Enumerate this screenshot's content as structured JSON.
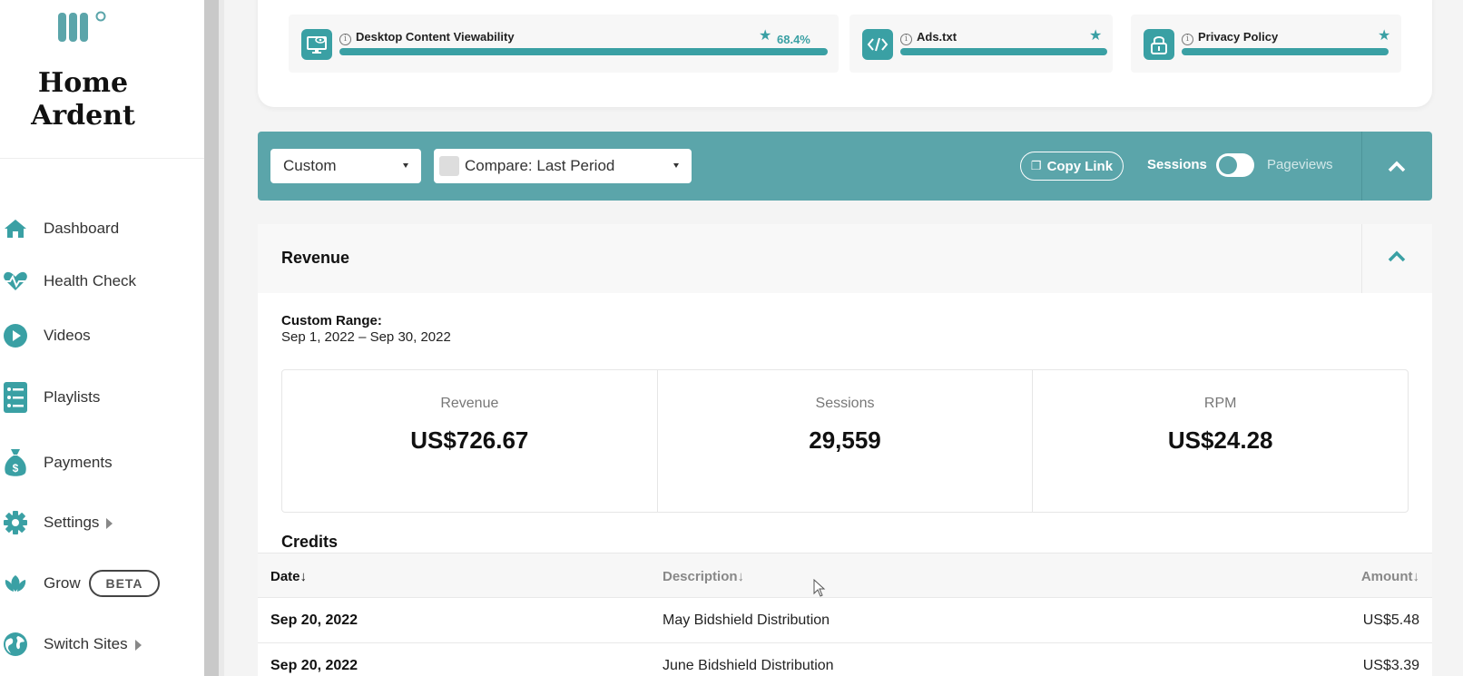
{
  "sidebar": {
    "brand_line1": "Home",
    "brand_line2": "Ardent",
    "items": [
      {
        "label": "Dashboard",
        "icon": "home-icon"
      },
      {
        "label": "Health Check",
        "icon": "heartbeat-icon"
      },
      {
        "label": "Videos",
        "icon": "play-icon"
      },
      {
        "label": "Playlists",
        "icon": "list-icon"
      },
      {
        "label": "Payments",
        "icon": "money-bag-icon"
      },
      {
        "label": "Settings",
        "icon": "gear-icon"
      },
      {
        "label": "Grow",
        "icon": "leaf-icon",
        "badge": "BETA"
      },
      {
        "label": "Switch Sites",
        "icon": "globe-icon"
      }
    ]
  },
  "health_check": {
    "tiles": [
      {
        "title": "Desktop Content Viewability",
        "value": "68.4%",
        "icon": "monitor-eye-icon"
      },
      {
        "title": "Ads.txt",
        "icon": "code-icon"
      },
      {
        "title": "Privacy Policy",
        "icon": "lock-icon"
      }
    ]
  },
  "filters": {
    "range_select": "Custom",
    "compare_select": "Compare: Last Period",
    "copy_link": "Copy Link",
    "toggle_left": "Sessions",
    "toggle_right": "Pageviews"
  },
  "revenue": {
    "title": "Revenue",
    "range_label": "Custom Range:",
    "range_dates": "Sep 1, 2022 – Sep 30, 2022",
    "stats": [
      {
        "label": "Revenue",
        "value": "US$726.67"
      },
      {
        "label": "Sessions",
        "value": "29,559"
      },
      {
        "label": "RPM",
        "value": "US$24.28"
      }
    ],
    "credits_title": "Credits",
    "columns": {
      "date": "Date↓",
      "description": "Description↓",
      "amount": "Amount↓"
    },
    "rows": [
      {
        "date": "Sep 20, 2022",
        "description": "May Bidshield Distribution",
        "amount": "US$5.48"
      },
      {
        "date": "Sep 20, 2022",
        "description": "June Bidshield Distribution",
        "amount": "US$3.39"
      }
    ]
  },
  "colors": {
    "accent": "#5ba5aa",
    "icon_teal": "#3aa0a4"
  }
}
